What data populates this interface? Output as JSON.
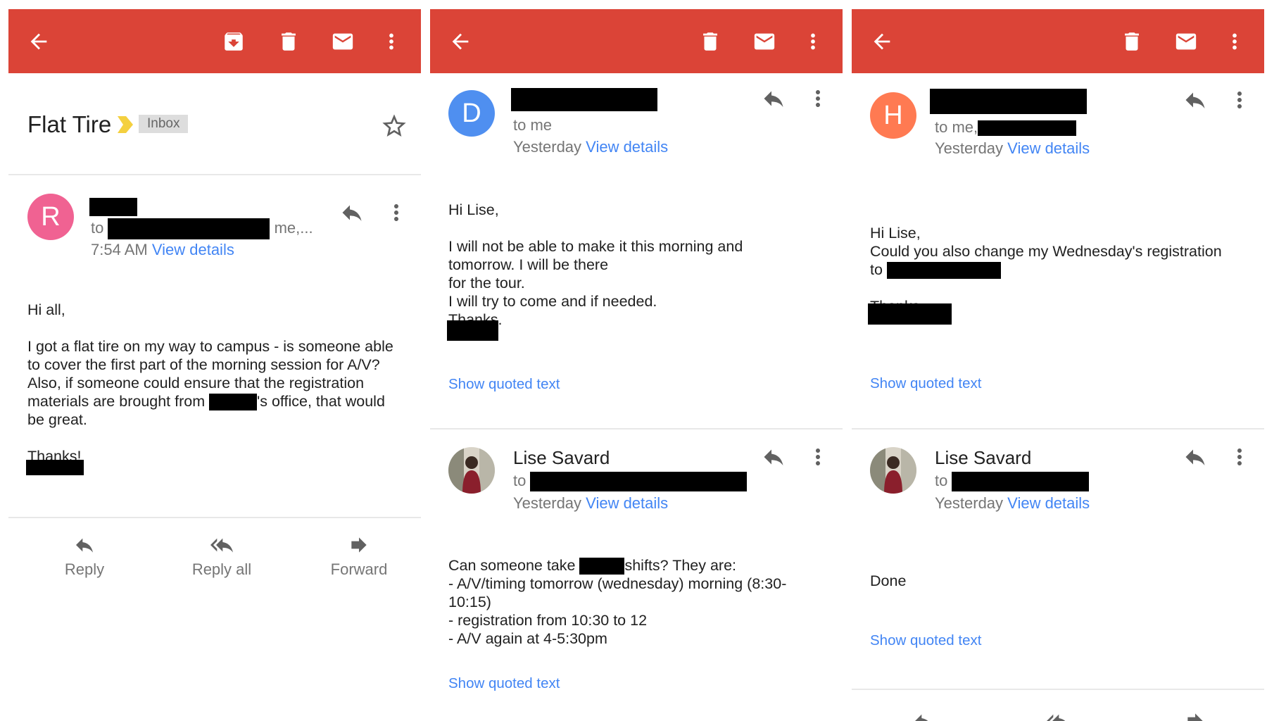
{
  "colors": {
    "toolbar": "#db4437",
    "link": "#4285f4",
    "avatar_r": "#f06292",
    "avatar_d": "#4f8ff0",
    "avatar_h": "#ff7a52"
  },
  "pane1": {
    "subject": "Flat Tire",
    "label": "Inbox",
    "message": {
      "avatar_letter": "R",
      "to_prefix": "to",
      "to_suffix": "me,...",
      "time": "7:54 AM",
      "view_details": "View details",
      "body": {
        "l1": "Hi all,",
        "l2": "I got a flat tire on my way to campus - is someone able",
        "l3": "to cover the first part of the morning session for A/V?",
        "l4": "Also, if someone could ensure that the registration",
        "l5a": "materials are brought from",
        "l5b": "'s office, that would",
        "l6": "be great.",
        "l7": "Thanks!"
      }
    },
    "actions": {
      "reply": "Reply",
      "reply_all": "Reply all",
      "forward": "Forward"
    }
  },
  "pane2": {
    "message1": {
      "avatar_letter": "D",
      "to_line": "to me",
      "time": "Yesterday",
      "view_details": "View details",
      "body": {
        "l1": "Hi Lise,",
        "l2": "I will not be able to make it this morning and",
        "l3": "tomorrow. I will be there",
        "l4": "for the tour.",
        "l5": "I will try to come and if needed.",
        "l6": "Thanks."
      },
      "show_quoted": "Show quoted text"
    },
    "message2": {
      "sender": "Lise Savard",
      "to_prefix": "to",
      "time": "Yesterday",
      "view_details": "View details",
      "body": {
        "l1a": "Can someone take",
        "l1b": "shifts? They are:",
        "l2": "- A/V/timing tomorrow (wednesday) morning (8:30-",
        "l3": "10:15)",
        "l4": "- registration from 10:30 to 12",
        "l5": "- A/V again at 4-5:30pm"
      },
      "show_quoted": "Show quoted text"
    }
  },
  "pane3": {
    "message1": {
      "avatar_letter": "H",
      "to_line": "to me,",
      "time": "Yesterday",
      "view_details": "View details",
      "body": {
        "l1": "Hi Lise,",
        "l2": "Could you also change my Wednesday's registration",
        "l3": "to",
        "l4": "Thanks,"
      },
      "show_quoted": "Show quoted text"
    },
    "message2": {
      "sender": "Lise Savard",
      "to_prefix": "to",
      "time": "Yesterday",
      "view_details": "View details",
      "body": {
        "l1": "Done"
      },
      "show_quoted": "Show quoted text"
    }
  }
}
